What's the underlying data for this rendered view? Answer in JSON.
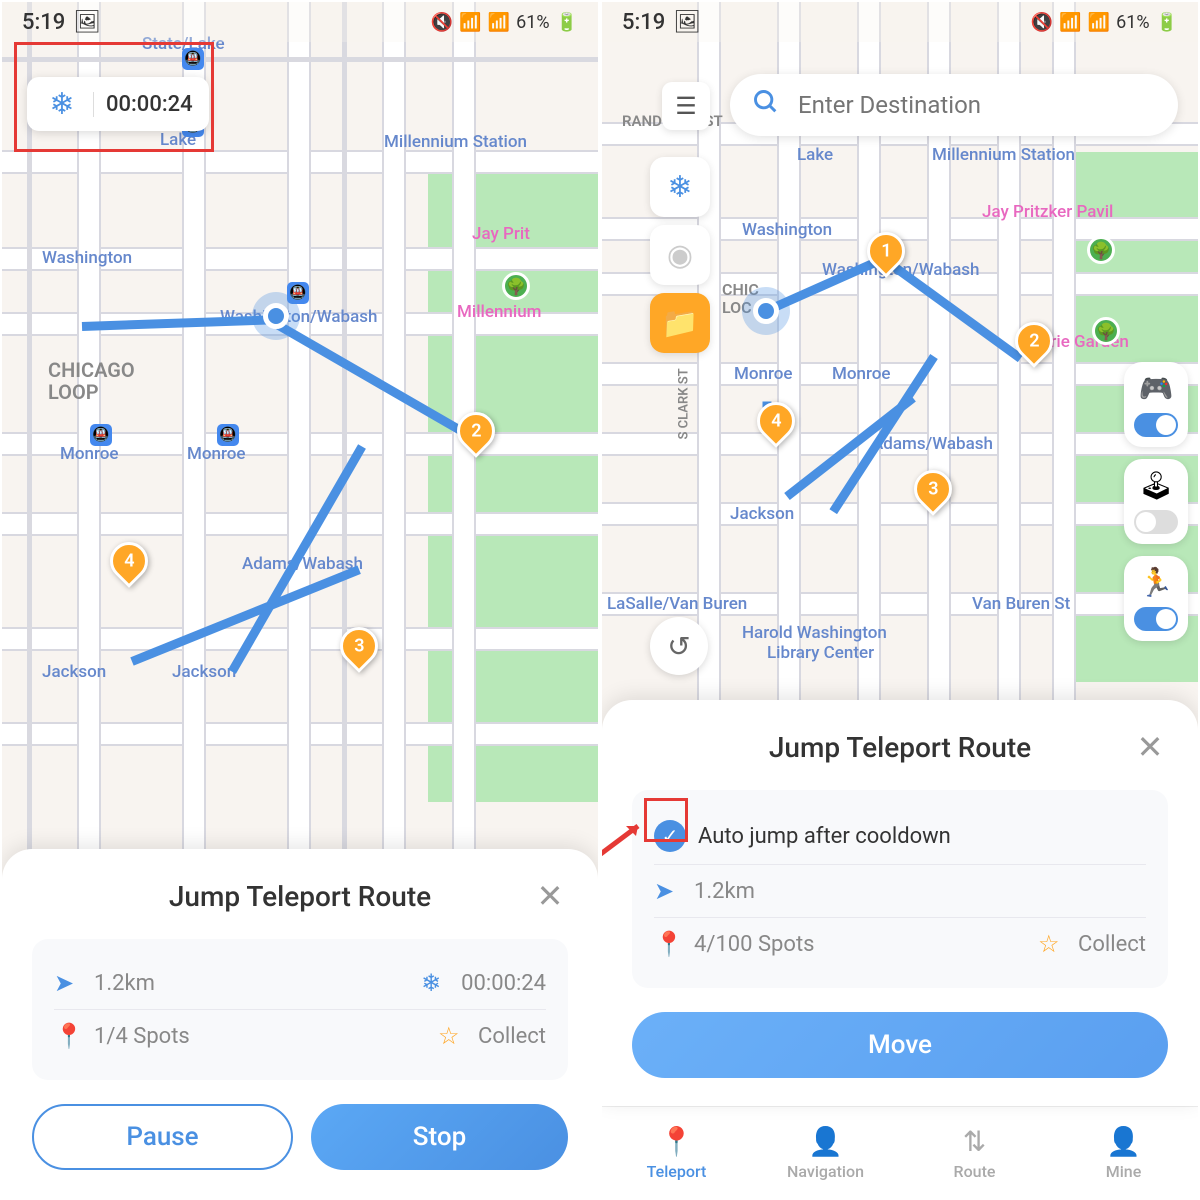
{
  "status": {
    "time": "5:19",
    "battery": "61%"
  },
  "left": {
    "timer": "00:00:24",
    "panel": {
      "title": "Jump Teleport Route",
      "distance": "1.2km",
      "cooldown": "00:00:24",
      "spots": "1/4 Spots",
      "collect": "Collect",
      "pause": "Pause",
      "stop": "Stop"
    }
  },
  "right": {
    "search": {
      "placeholder": "Enter Destination"
    },
    "panel": {
      "title": "Jump Teleport Route",
      "autojump": "Auto jump after cooldown",
      "distance": "1.2km",
      "spots": "4/100 Spots",
      "collect": "Collect",
      "move": "Move"
    },
    "nav": {
      "teleport": "Teleport",
      "navigation": "Navigation",
      "route": "Route",
      "mine": "Mine"
    }
  },
  "map_labels": {
    "state_lake": "State/Lake",
    "lake": "Lake",
    "millennium": "Millennium Station",
    "wash_wabash": "Washington/Wabash",
    "chicago_loop": "CHICAGO",
    "chicago_loop2": "LOOP",
    "monroe": "Monroe",
    "adams_wabash": "Adams/Wabash",
    "jackson": "Jackson",
    "washington": "Washington",
    "jay_pritzker": "Jay Pritzker Pavil",
    "millennium_park": "Millennium",
    "lurie": "Lurie Garden",
    "lasalle": "LaSalle/Van Buren",
    "vanburen": "Van Buren St",
    "harold1": "Harold Washington",
    "harold2": "Library Center",
    "randolph": "RANDOLPH ST",
    "clark": "S CLARK ST"
  },
  "waypoints": [
    "1",
    "2",
    "3",
    "4"
  ]
}
